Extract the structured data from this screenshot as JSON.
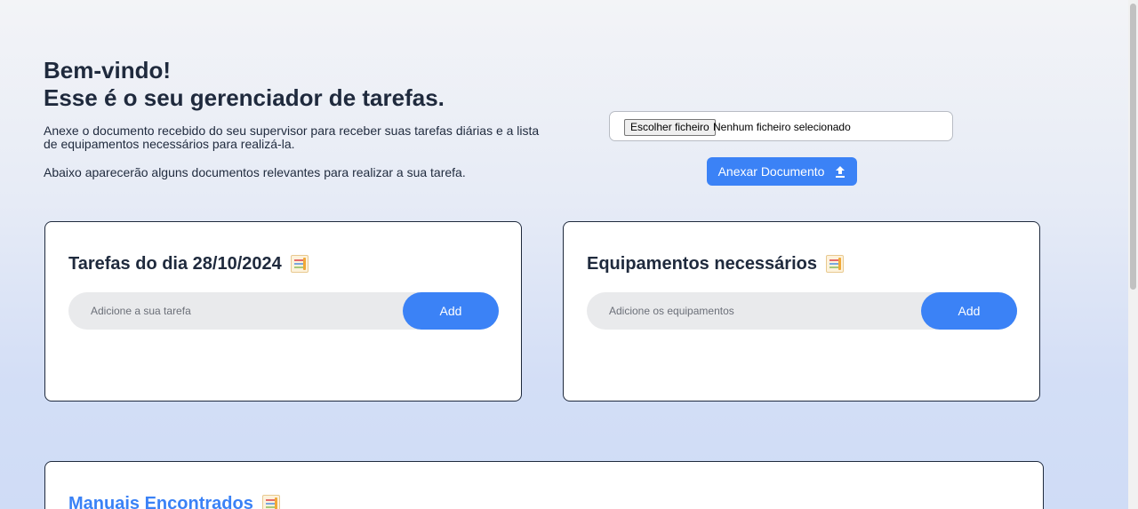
{
  "header": {
    "title_line1": "Bem-vindo!",
    "title_line2": "Esse é o seu gerenciador de tarefas.",
    "intro": "Anexe o documento recebido do seu supervisor para receber suas tarefas diárias e a lista de equipamentos necessários para realizá-la.",
    "note": "Abaixo aparecerão alguns documentos relevantes para realizar a sua tarefa."
  },
  "upload": {
    "choose_label": "Escolher ficheiro",
    "status": "Nenhum ficheiro selecionado",
    "attach_label": "Anexar Documento",
    "attach_icon": "upload-icon"
  },
  "tasks": {
    "title": "Tarefas do dia 28/10/2024",
    "icon": "notepad-icon",
    "placeholder": "Adicione a sua tarefa",
    "value": "",
    "add_label": "Add"
  },
  "equipment": {
    "title": "Equipamentos necessários",
    "icon": "notepad-icon",
    "placeholder": "Adicione os equipamentos",
    "value": "",
    "add_label": "Add"
  },
  "manuals": {
    "title": "Manuais Encontrados",
    "icon": "notepad-icon"
  },
  "colors": {
    "accent": "#3b82f6",
    "text": "#1f2a3d",
    "input_bg": "#e9eaec"
  }
}
